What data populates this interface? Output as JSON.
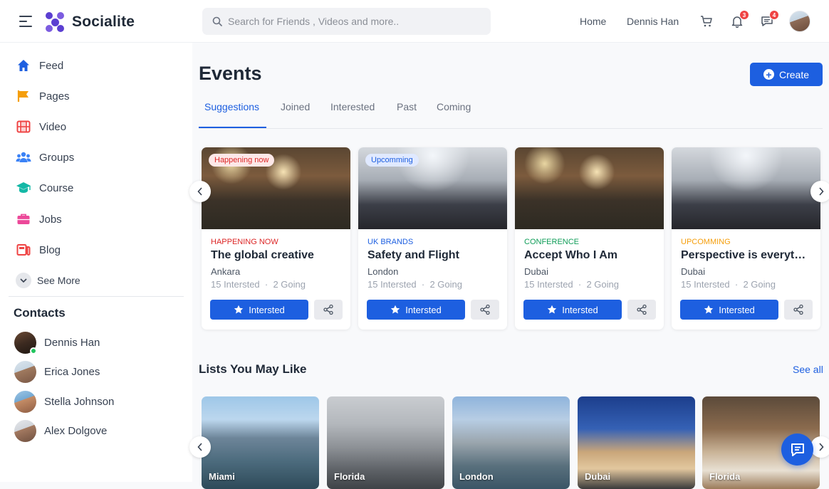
{
  "app": {
    "name": "Socialite"
  },
  "search": {
    "placeholder": "Search for Friends , Videos and more.."
  },
  "topnav": {
    "home": "Home",
    "user": "Dennis Han",
    "notifications_count": "3",
    "messages_count": "4"
  },
  "sidebar": {
    "items": [
      {
        "label": "Feed",
        "icon": "home-icon",
        "color": "#1d5fe0"
      },
      {
        "label": "Pages",
        "icon": "flag-icon",
        "color": "#f59e0b"
      },
      {
        "label": "Video",
        "icon": "film-icon",
        "color": "#ef4444"
      },
      {
        "label": "Groups",
        "icon": "users-icon",
        "color": "#3b82f6"
      },
      {
        "label": "Course",
        "icon": "graduation-cap-icon",
        "color": "#14b8a6"
      },
      {
        "label": "Jobs",
        "icon": "briefcase-icon",
        "color": "#ec4899"
      },
      {
        "label": "Blog",
        "icon": "blog-icon",
        "color": "#ef4444"
      }
    ],
    "see_more": "See More"
  },
  "contacts": {
    "title": "Contacts",
    "items": [
      {
        "name": "Dennis Han",
        "online": true
      },
      {
        "name": "Erica Jones",
        "online": false
      },
      {
        "name": "Stella Johnson",
        "online": false
      },
      {
        "name": "Alex Dolgove",
        "online": false
      }
    ]
  },
  "events": {
    "title": "Events",
    "create_label": "Create",
    "tabs": [
      "Suggestions",
      "Joined",
      "Interested",
      "Past",
      "Coming"
    ],
    "active_tab": "Suggestions",
    "cards": [
      {
        "badge": "Happening now",
        "category": "HAPPENING NOW",
        "category_color": "#dc2626",
        "title": "The global creative",
        "location": "Ankara",
        "interested": "15 Intersted",
        "going": "2 Going",
        "button": "Intersted"
      },
      {
        "badge": "Upcomming",
        "category": "UK BRANDS",
        "category_color": "#1d5fe0",
        "title": "Safety and Flight",
        "location": "London",
        "interested": "15 Intersted",
        "going": "2 Going",
        "button": "Intersted"
      },
      {
        "badge": "",
        "category": "CONFERENCE",
        "category_color": "#0f9d58",
        "title": "Accept Who I Am",
        "location": "Dubai",
        "interested": "15 Intersted",
        "going": "2 Going",
        "button": "Intersted"
      },
      {
        "badge": "",
        "category": "UPCOMMING",
        "category_color": "#f59e0b",
        "title": "Perspective is everyt…",
        "location": "Dubai",
        "interested": "15 Intersted",
        "going": "2 Going",
        "button": "Intersted"
      }
    ]
  },
  "lists": {
    "title": "Lists You May Like",
    "see_all": "See all",
    "places": [
      "Miami",
      "Florida",
      "London",
      "Dubai",
      "Florida"
    ]
  }
}
